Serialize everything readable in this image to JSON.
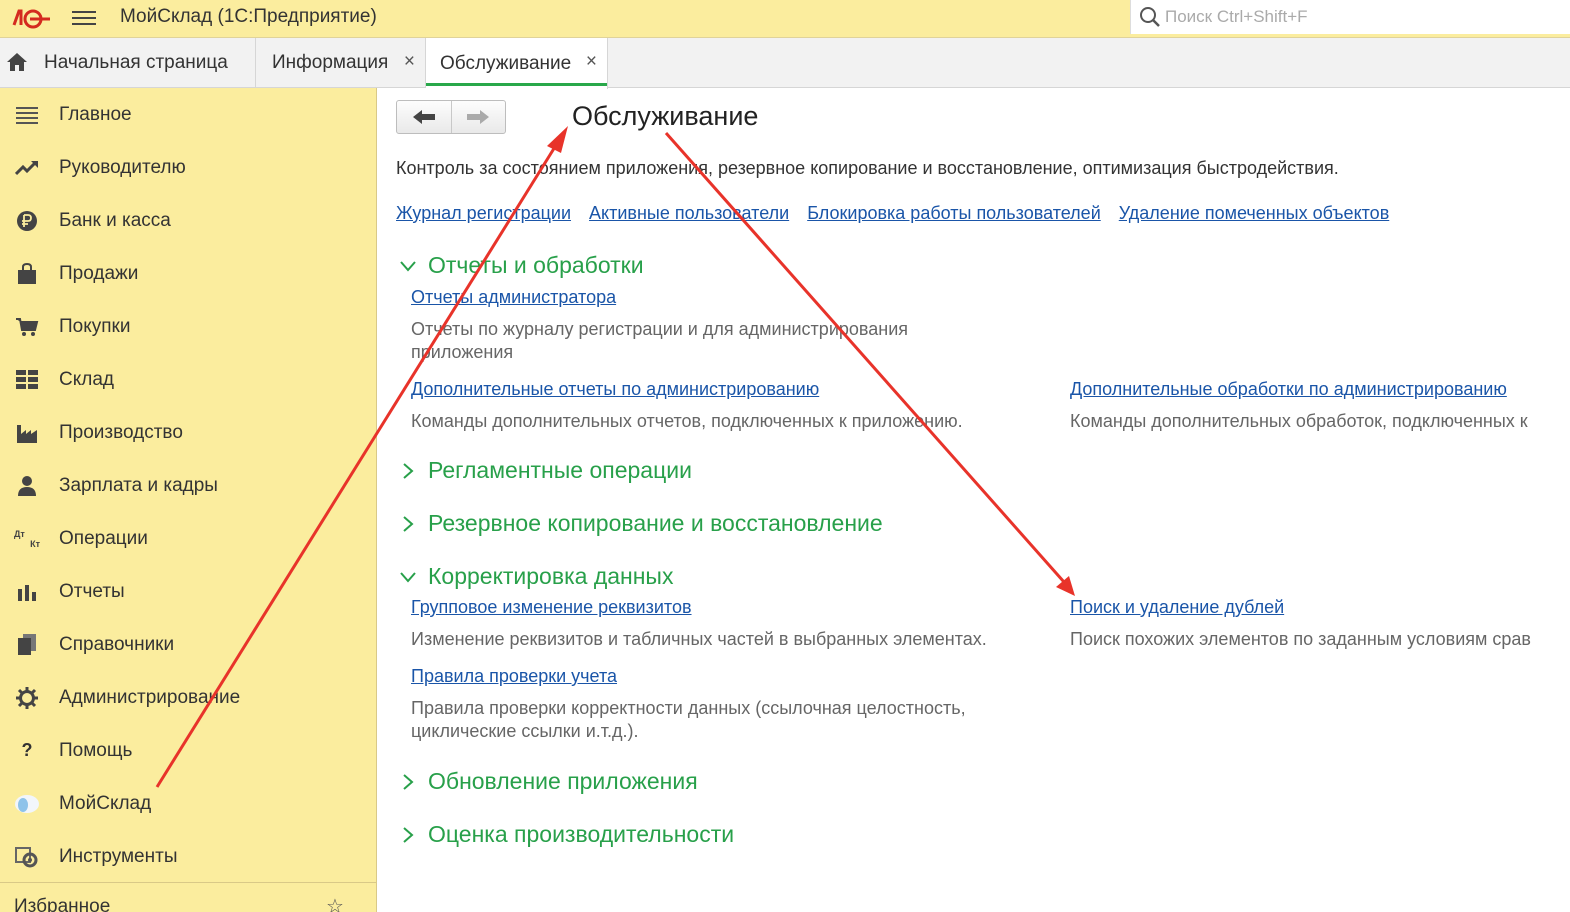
{
  "titlebar": {
    "app_title": "МойСклад  (1С:Предприятие)",
    "search_placeholder": "Поиск Ctrl+Shift+F"
  },
  "tabs": [
    {
      "label": "Начальная страница"
    },
    {
      "label": "Информация",
      "close": "×"
    },
    {
      "label": "Обслуживание",
      "close": "×",
      "active": true
    }
  ],
  "sidebar": {
    "items": [
      {
        "label": "Главное",
        "icon": "menu-lines-icon"
      },
      {
        "label": "Руководителю",
        "icon": "trend-icon"
      },
      {
        "label": "Банк и касса",
        "icon": "ruble-coin-icon"
      },
      {
        "label": "Продажи",
        "icon": "shopping-bag-icon"
      },
      {
        "label": "Покупки",
        "icon": "cart-icon"
      },
      {
        "label": "Склад",
        "icon": "warehouse-icon"
      },
      {
        "label": "Производство",
        "icon": "factory-icon"
      },
      {
        "label": "Зарплата и кадры",
        "icon": "person-icon"
      },
      {
        "label": "Операции",
        "icon": "dt-kt-icon"
      },
      {
        "label": "Отчеты",
        "icon": "bar-chart-icon"
      },
      {
        "label": "Справочники",
        "icon": "books-icon"
      },
      {
        "label": "Администрирование",
        "icon": "gear-icon"
      },
      {
        "label": "Помощь",
        "icon": "question-icon"
      },
      {
        "label": "МойСклад",
        "icon": "moysklad-icon"
      },
      {
        "label": "Инструменты",
        "icon": "tools-icon"
      }
    ],
    "favorites_label": "Избранное",
    "dt_label": "Дт",
    "kt_label": "Кт",
    "help_glyph": "?"
  },
  "main": {
    "title": "Обслуживание",
    "description": "Контроль за состоянием приложения, резервное копирование и восстановление, оптимизация быстродействия.",
    "top_links": [
      "Журнал регистрации",
      "Активные пользователи",
      "Блокировка работы пользователей",
      "Удаление помеченных объектов"
    ],
    "sections": {
      "reports": {
        "title": "Отчеты и обработки",
        "admin_reports_link": "Отчеты администратора",
        "admin_reports_note_1": "Отчеты по журналу регистрации и для администрирования",
        "admin_reports_note_2": "приложения",
        "extra_reports_link": "Дополнительные отчеты по администрированию",
        "extra_reports_note": "Команды дополнительных отчетов, подключенных к приложению.",
        "extra_processing_link": "Дополнительные обработки по администрированию",
        "extra_processing_note": "Команды дополнительных обработок, подключенных к"
      },
      "routine": {
        "title": "Регламентные операции"
      },
      "backup": {
        "title": "Резервное копирование и восстановление"
      },
      "correction": {
        "title": "Корректировка данных",
        "group_change_link": "Групповое изменение реквизитов",
        "group_change_note": "Изменение реквизитов и табличных частей в выбранных элементах.",
        "duplicates_link": "Поиск и удаление дублей",
        "duplicates_note": "Поиск похожих элементов по заданным условиям срав",
        "rules_link": "Правила проверки учета",
        "rules_note_1": "Правила проверки корректности данных (ссылочная целостность,",
        "rules_note_2": "циклические ссылки и.т.д.)."
      },
      "update": {
        "title": "Обновление приложения"
      },
      "performance": {
        "title": "Оценка производительности"
      }
    }
  },
  "colors": {
    "titlebar_bg": "#fbed9e",
    "section_green": "#28a04a",
    "link_blue": "#1a55a8",
    "annotation_red": "#e8332a"
  }
}
